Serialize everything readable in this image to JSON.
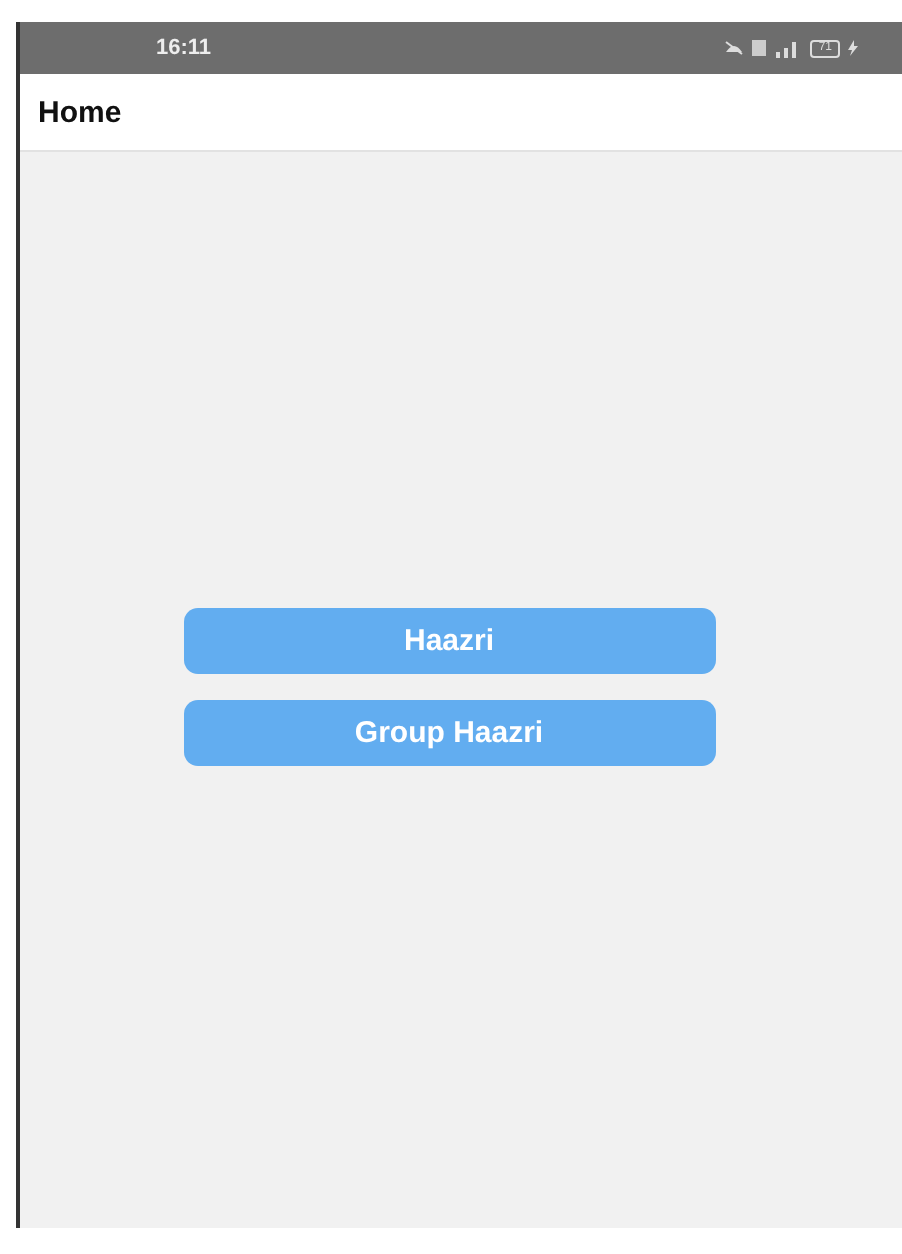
{
  "status_bar": {
    "time": "16:11",
    "battery": "71"
  },
  "header": {
    "title": "Home"
  },
  "buttons": [
    "Haazri",
    "Group Haazri"
  ]
}
